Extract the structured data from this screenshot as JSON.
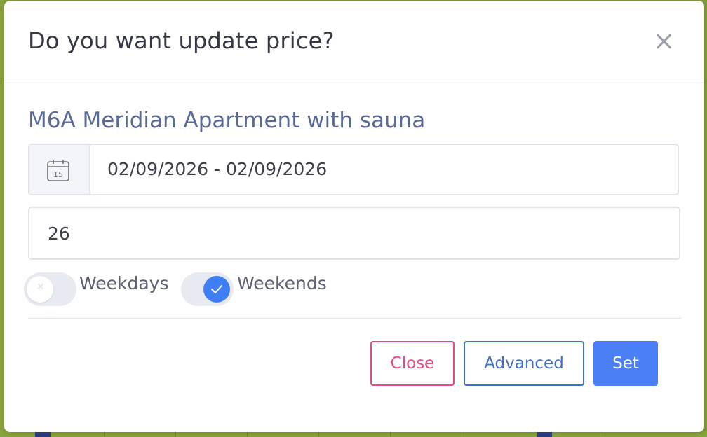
{
  "modal": {
    "title": "Do you want update price?",
    "close_icon": "close-icon"
  },
  "apartment": {
    "name": "M6A Meridian Apartment with sauna"
  },
  "date_range": {
    "icon": "calendar-icon",
    "icon_day": "15",
    "value": "02/09/2026 - 02/09/2026"
  },
  "price": {
    "value": "26"
  },
  "toggles": {
    "weekdays": {
      "label": "Weekdays",
      "checked": false
    },
    "weekends": {
      "label": "Weekends",
      "checked": true
    }
  },
  "buttons": {
    "close": "Close",
    "advanced": "Advanced",
    "set": "Set"
  },
  "colors": {
    "accent": "#4a7ff5",
    "danger": "#e84a7f",
    "outline_primary": "#3f6fc9",
    "title_text": "#353845",
    "apartment_text": "#5a6a96"
  }
}
